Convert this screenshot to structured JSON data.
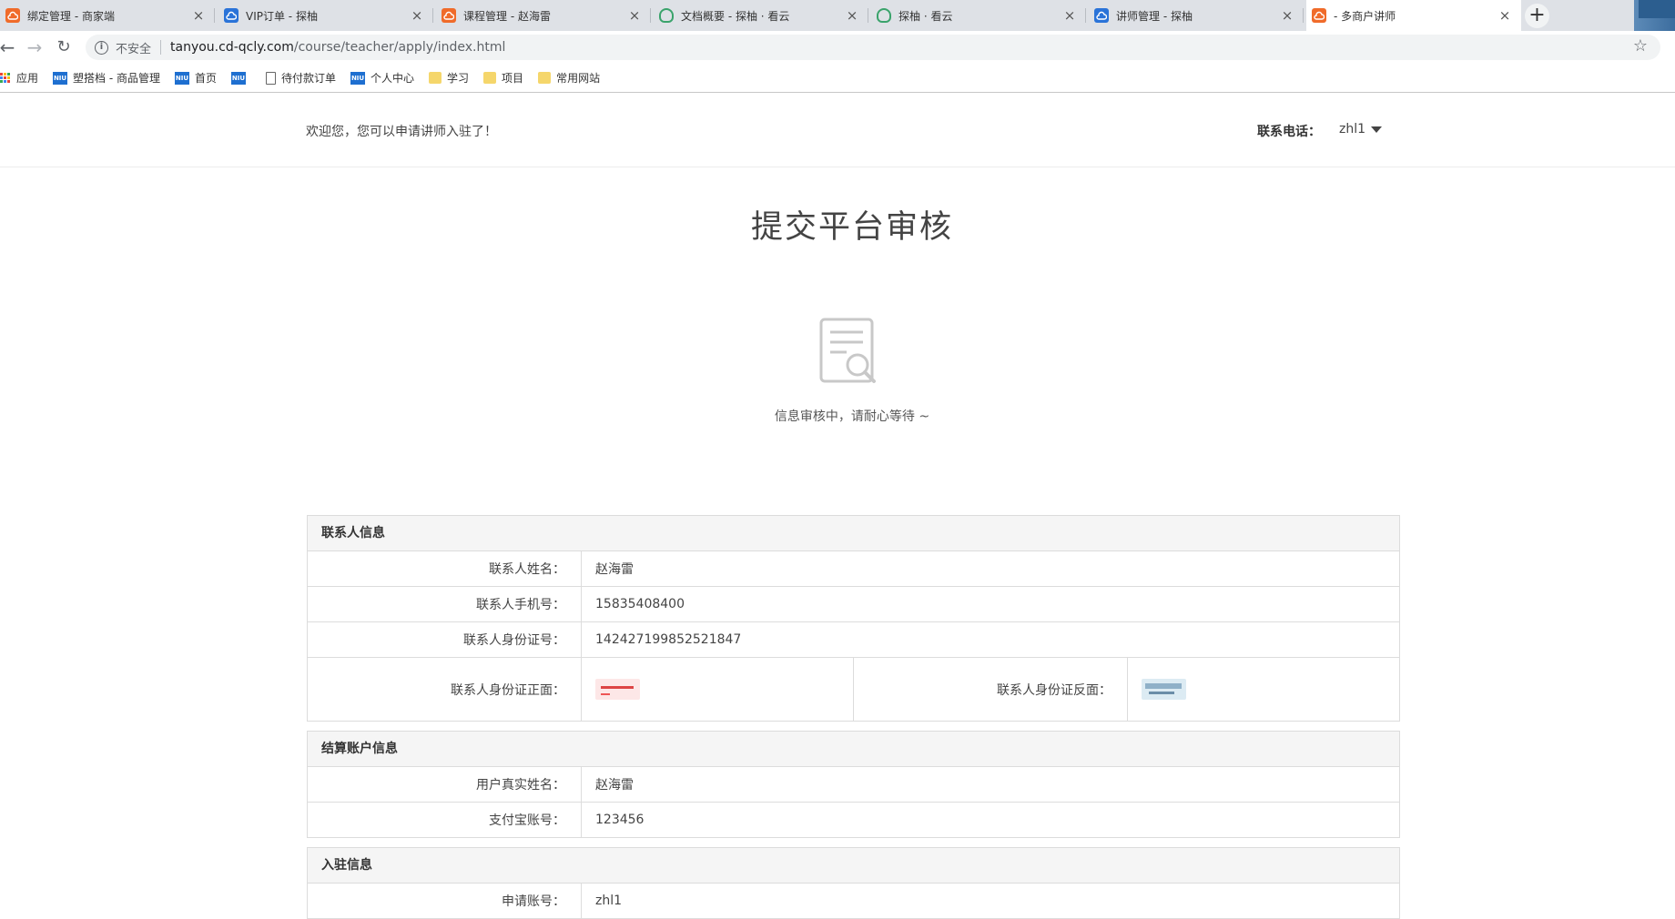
{
  "browser": {
    "tabs": [
      {
        "title": "绑定管理 - 商家端",
        "icon": "orange-cloud-icon"
      },
      {
        "title": "VIP订单 - 探柚",
        "icon": "blue-cloud-icon"
      },
      {
        "title": "课程管理 - 赵海雷",
        "icon": "orange-cloud-icon"
      },
      {
        "title": "文档概要 - 探柚 · 看云",
        "icon": "green-cloud-icon"
      },
      {
        "title": "探柚 · 看云",
        "icon": "green-cloud-icon"
      },
      {
        "title": "讲师管理 - 探柚",
        "icon": "blue-cloud-icon"
      },
      {
        "title": "- 多商户讲师",
        "icon": "orange-cloud-icon",
        "active": true
      }
    ],
    "address": {
      "security_label": "不安全",
      "url_host": "tanyou.cd-qcly.com",
      "url_path": "/course/teacher/apply/index.html"
    },
    "bookmarks": [
      {
        "label": "应用",
        "icon": "apps-grid-icon"
      },
      {
        "label": "塑搭档 - 商品管理",
        "icon": "niu-icon"
      },
      {
        "label": "首页",
        "icon": "niu-icon"
      },
      {
        "label": "",
        "icon": "niu-icon"
      },
      {
        "label": "待付款订单",
        "icon": "page-icon"
      },
      {
        "label": "个人中心",
        "icon": "niu-icon"
      },
      {
        "label": "学习",
        "icon": "folder-icon"
      },
      {
        "label": "项目",
        "icon": "folder-icon"
      },
      {
        "label": "常用网站",
        "icon": "folder-icon"
      }
    ]
  },
  "header": {
    "welcome": "欢迎您，您可以申请讲师入驻了！",
    "contact_label": "联系电话：",
    "username": "zhl1"
  },
  "main": {
    "title": "提交平台审核",
    "status": "信息审核中，请耐心等待 ~"
  },
  "contact_section": {
    "title": "联系人信息",
    "name_label": "联系人姓名：",
    "name_value": "赵海雷",
    "phone_label": "联系人手机号：",
    "phone_value": "15835408400",
    "id_label": "联系人身份证号：",
    "id_value": "142427199852521847",
    "id_front_label": "联系人身份证正面：",
    "id_back_label": "联系人身份证反面："
  },
  "settlement_section": {
    "title": "结算账户信息",
    "realname_label": "用户真实姓名：",
    "realname_value": "赵海雷",
    "alipay_label": "支付宝账号：",
    "alipay_value": "123456"
  },
  "join_section": {
    "title": "入驻信息",
    "account_label": "申请账号：",
    "account_value": "zhl1"
  }
}
